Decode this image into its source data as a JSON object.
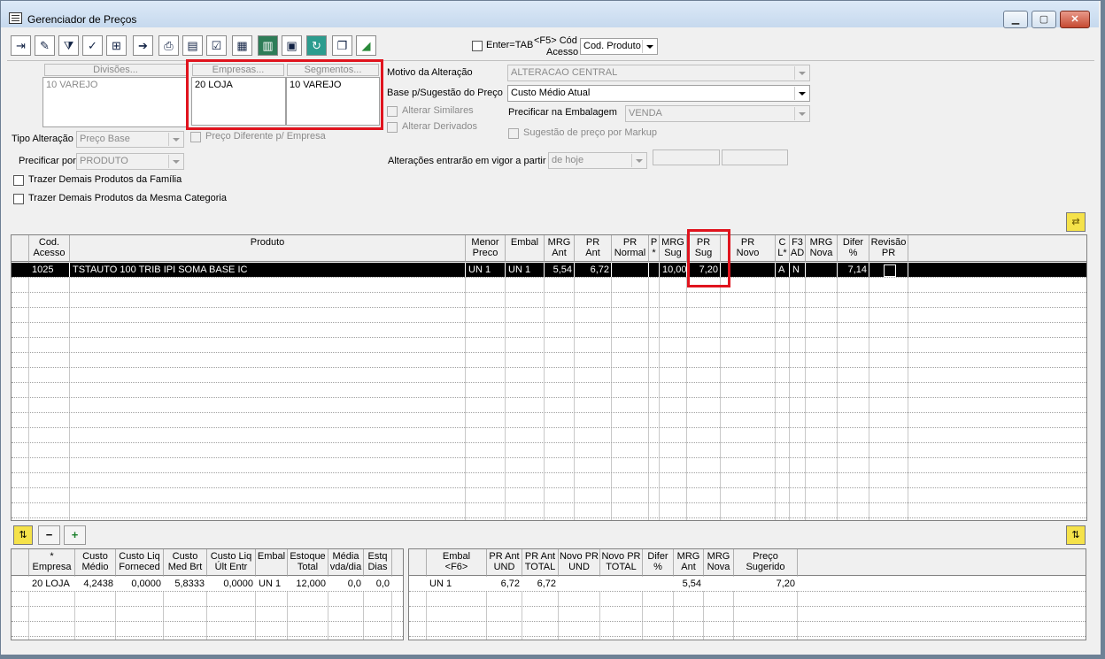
{
  "window": {
    "title": "Gerenciador de Preços"
  },
  "toolbar": {
    "buttons": [
      "exit-icon",
      "eraser-icon",
      "filter-icon",
      "filter-check-icon",
      "add-row-icon",
      "import-icon",
      "print-icon",
      "edit-form-icon",
      "checklist-icon",
      "grid-edit-icon",
      "spreadsheet-icon",
      "save-icon",
      "refresh-icon",
      "copy-window-icon",
      "chart-icon"
    ],
    "enter_tab_label": "Enter=TAB",
    "f5_label_line1": "<F5> Cód",
    "f5_label_line2": "Acesso",
    "f5_select_value": "Cod. Produto"
  },
  "filters": {
    "divisoes_header": "Divisões...",
    "divisoes_value": "10 VAREJO",
    "empresas_header": "Empresas...",
    "empresas_value": "20 LOJA",
    "segmentos_header": "Segmentos...",
    "segmentos_value": "10 VAREJO",
    "tipo_alteracao_label": "Tipo Alteração",
    "tipo_alteracao_value": "Preço Base",
    "preco_diferente_label": "Preço Diferente p/ Empresa",
    "precificar_por_label": "Precificar por",
    "precificar_por_value": "PRODUTO",
    "trazer_familia_label": "Trazer Demais Produtos da Família",
    "trazer_categoria_label": "Trazer Demais Produtos da Mesma Categoria"
  },
  "options": {
    "motivo_label": "Motivo da Alteração",
    "motivo_value": "ALTERACAO CENTRAL",
    "base_label": "Base p/Sugestão do Preço",
    "base_value": "Custo Médio Atual",
    "alterar_similares_label": "Alterar Similares",
    "alterar_derivados_label": "Alterar Derivados",
    "precificar_embalagem_label": "Precificar na Embalagem",
    "precificar_embalagem_value": "VENDA",
    "sugestao_markup_label": "Sugestão de preço por Markup",
    "vigor_label": "Alterações entrarão em vigor a partir",
    "vigor_value": "de hoje"
  },
  "main_grid": {
    "columns": [
      "Cod.\nAcesso",
      "Produto",
      "Menor\nPreco",
      "Embal",
      "MRG\nAnt",
      "PR\nAnt",
      "PR\nNormal",
      "P\n*",
      "MRG\nSug",
      "PR Sug",
      "PR\nNovo",
      "C\nL*",
      "F3\nAD",
      "MRG\nNova",
      "Difer\n%",
      "Revisão\nPR"
    ],
    "row": [
      "1025",
      "TSTAUTO 100 TRIB IPI SOMA BASE IC",
      "UN 1",
      "UN 1",
      "5,54",
      "6,72",
      "",
      "",
      "10,00",
      "7,20",
      "",
      "A",
      "N",
      "",
      "7,14",
      ""
    ]
  },
  "bottom_buttons": {
    "minus": "−",
    "plus": "+"
  },
  "empresa_grid": {
    "columns": [
      "* Empresa",
      "Custo\nMédio",
      "Custo Liq\nForneced",
      "Custo\nMed Brt",
      "Custo Liq\nÚlt Entr",
      "Embal",
      "Estoque\nTotal",
      "Média\nvda/dia",
      "Estq\nDias"
    ],
    "row": [
      "20 LOJA",
      "4,2438",
      "0,0000",
      "5,8333",
      "0,0000",
      "UN 1",
      "12,000",
      "0,0",
      "0,0"
    ]
  },
  "embal_grid": {
    "columns": [
      "Embal\n<F6>",
      "PR Ant\nUND",
      "PR Ant\nTOTAL",
      "Novo PR\nUND",
      "Novo PR\nTOTAL",
      "Difer\n%",
      "MRG\nAnt",
      "MRG\nNova",
      "Preço\nSugerido"
    ],
    "row": [
      "UN 1",
      "6,72",
      "6,72",
      "",
      "",
      "",
      "5,54",
      "",
      "7,20"
    ]
  }
}
